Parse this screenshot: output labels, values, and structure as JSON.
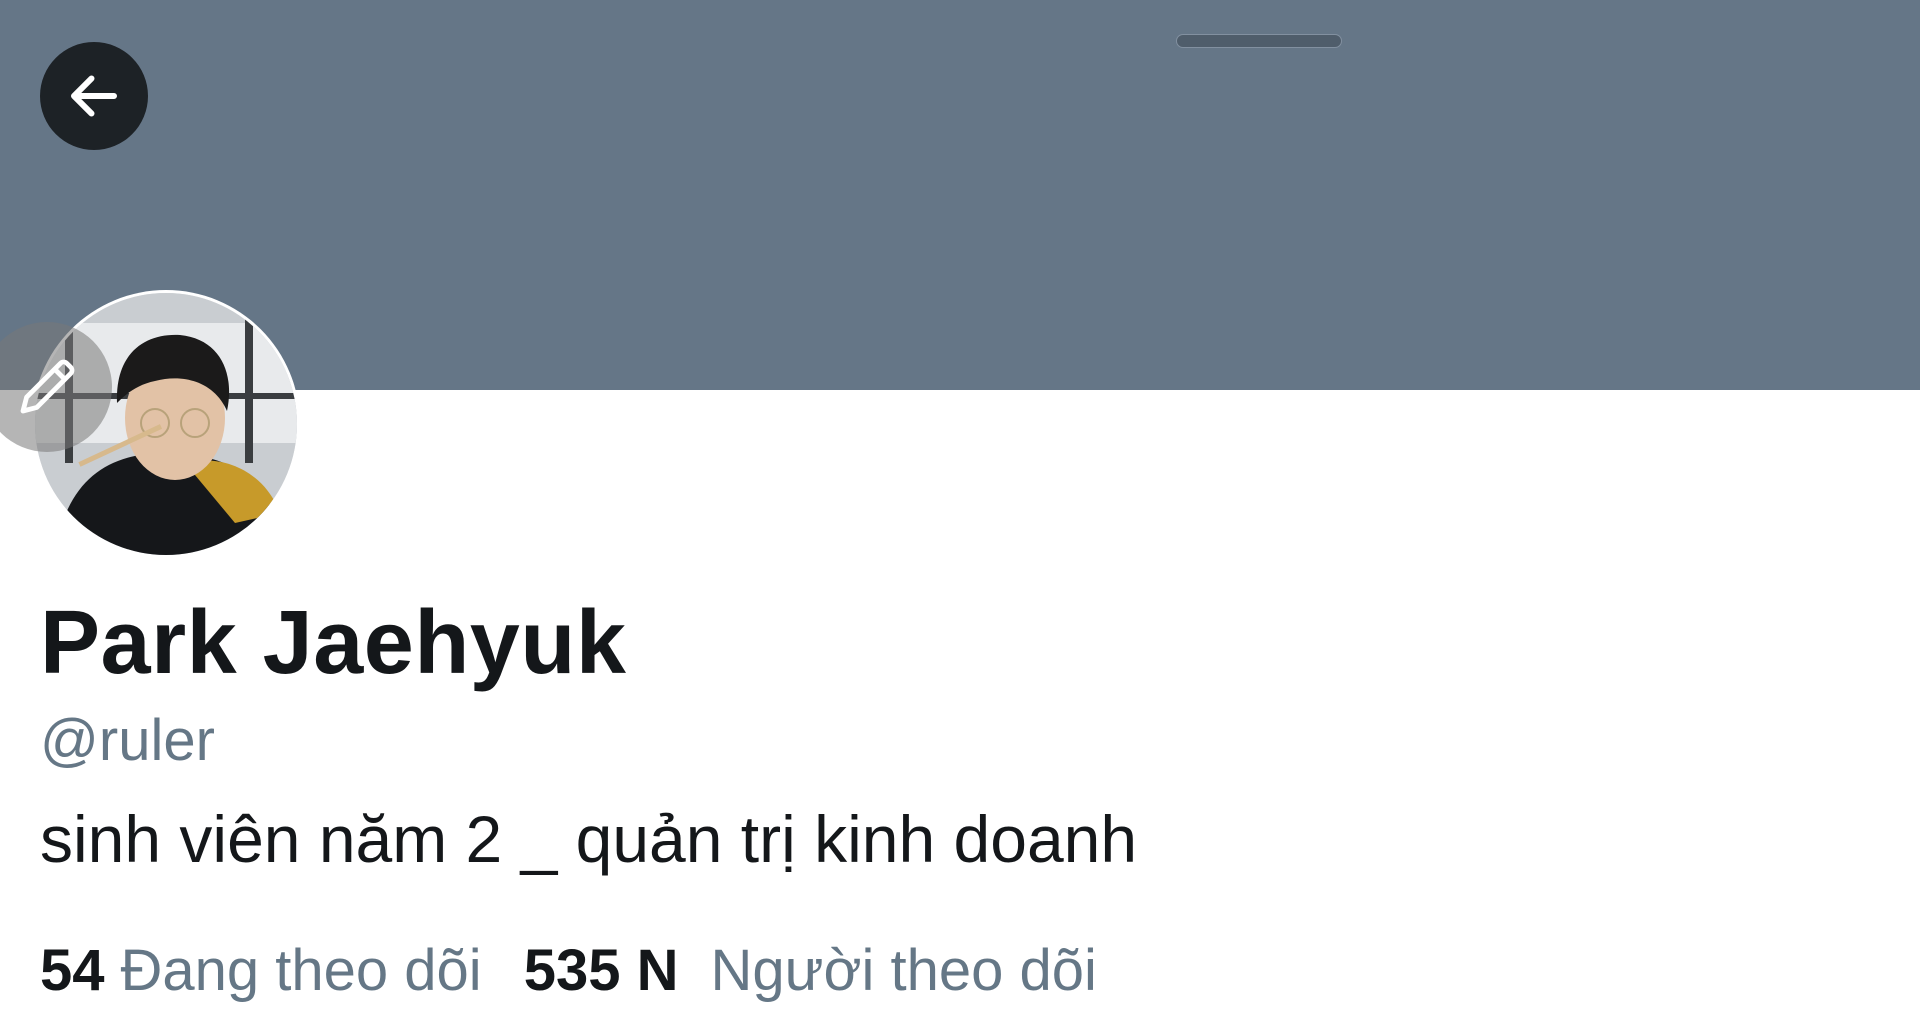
{
  "header": {
    "banner_color": "#657687",
    "back_icon": "arrow-left-icon"
  },
  "profile": {
    "avatar_icon": "profile-photo",
    "edit_icon": "pencil-icon",
    "display_name": "Park Jaehyuk",
    "handle": "@ruler",
    "bio": "sinh viên năm 2 _ quản trị kinh doanh"
  },
  "stats": {
    "following_count": "54",
    "following_label": "Đang theo dõi",
    "followers_count": "535 N",
    "followers_label": "Người theo dõi"
  }
}
